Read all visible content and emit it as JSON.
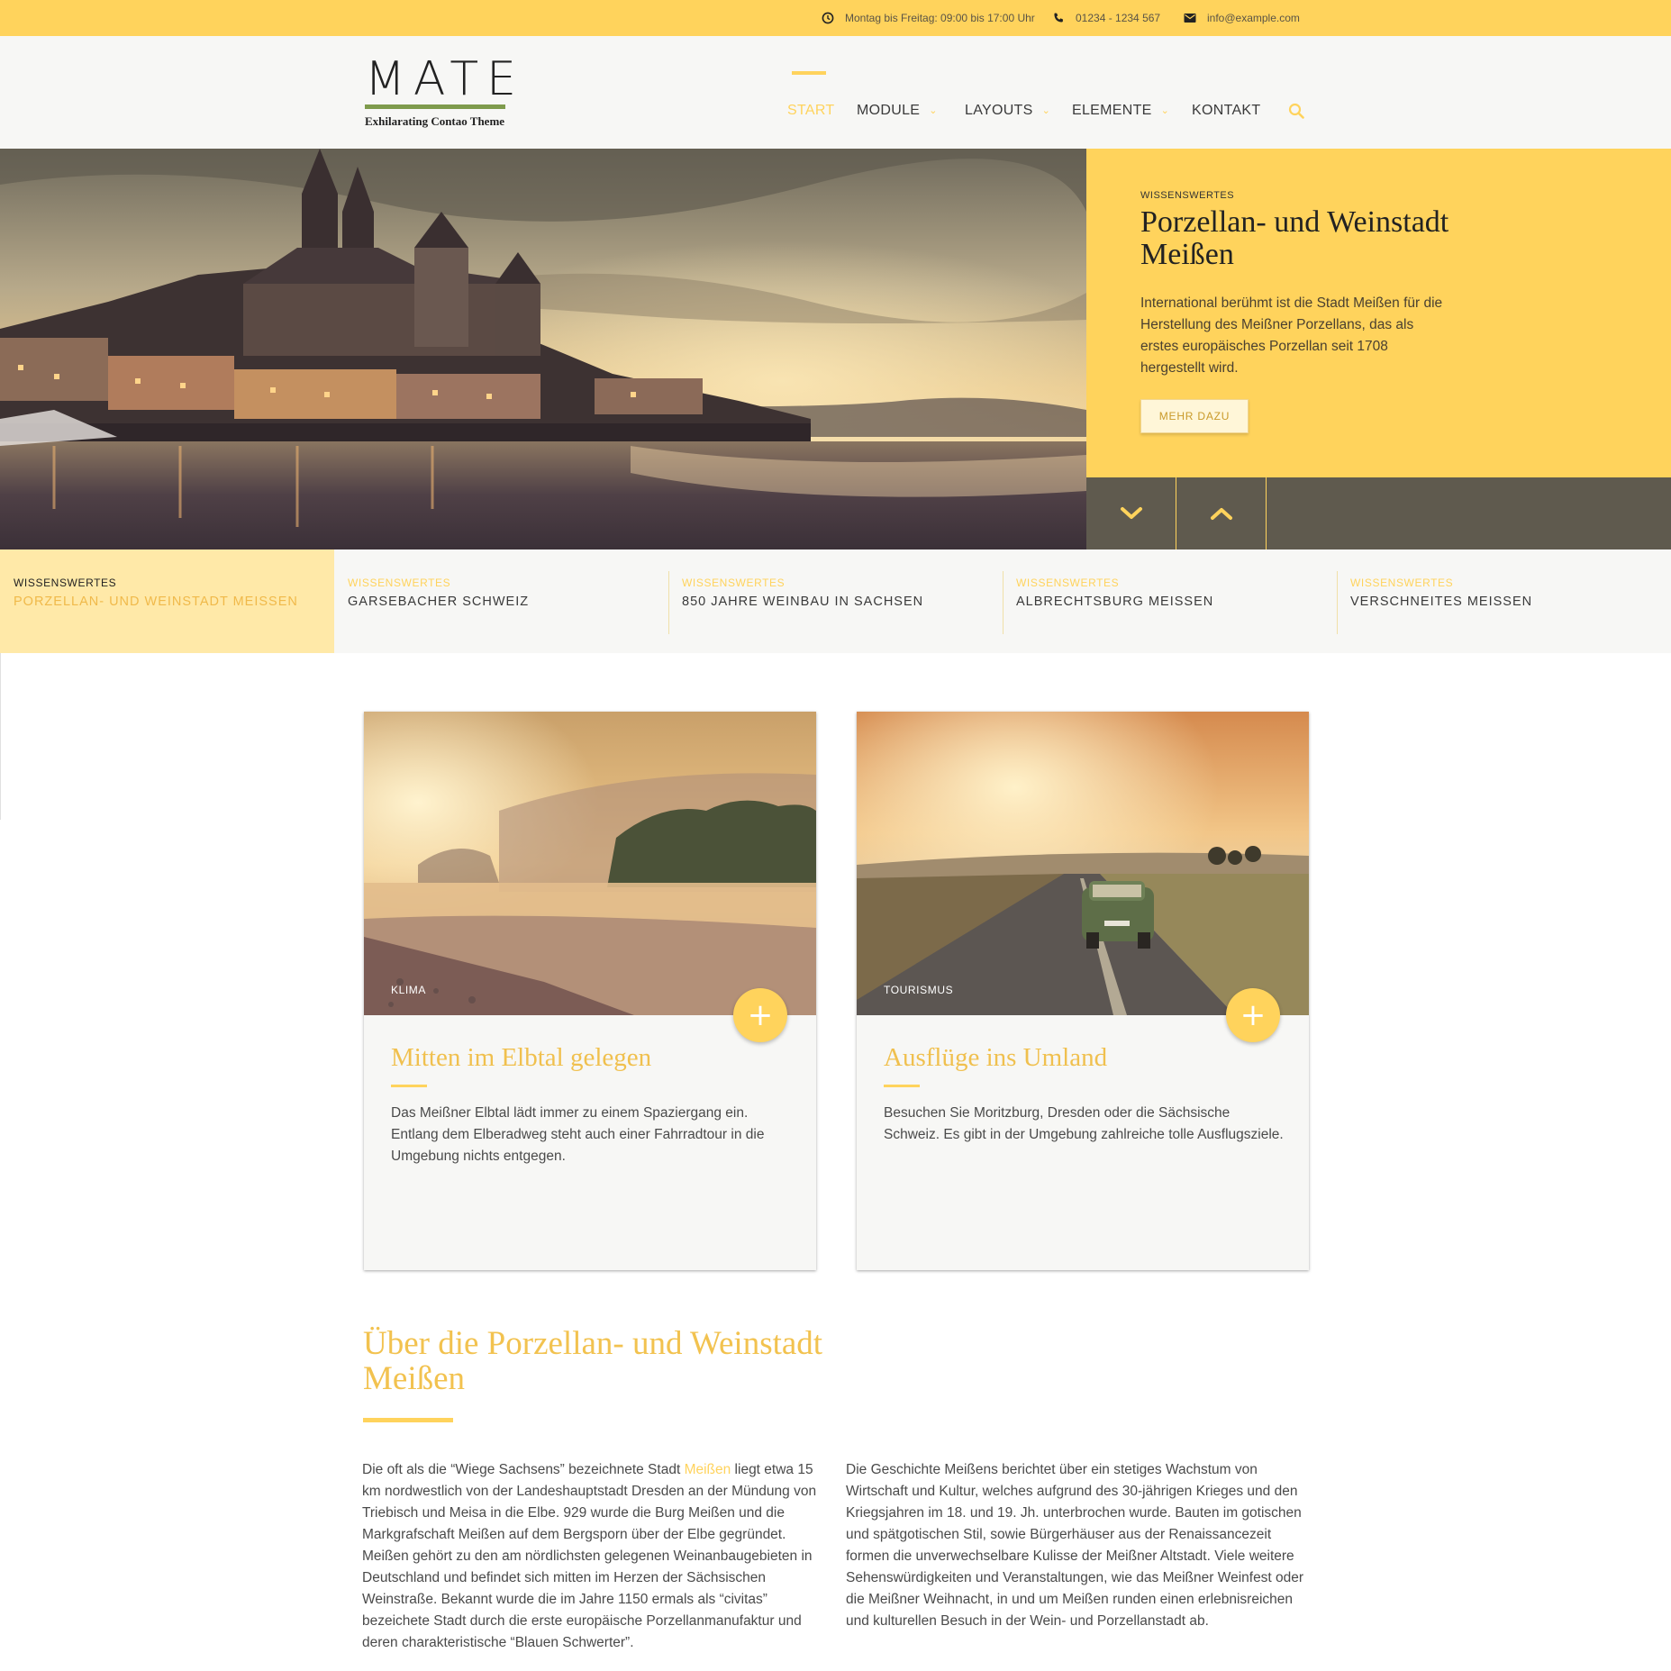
{
  "topbar": {
    "hours": "Montag bis Freitag: 09:00 bis 17:00 Uhr",
    "phone": "01234 - 1234 567",
    "email": "info@example.com"
  },
  "logo": {
    "word": "MATE",
    "tagline": "Exhilarating Contao Theme"
  },
  "nav": {
    "items": [
      "START",
      "MODULE",
      "LAYOUTS",
      "ELEMENTE",
      "KONTAKT"
    ],
    "dropdown_icon": "chevron-down-icon",
    "search_icon": "search-icon"
  },
  "hero": {
    "kicker": "WISSENSWERTES",
    "title": "Porzellan- und Weinstadt Meißen",
    "text": "International berühmt ist die Stadt Meißen für die Herstellung des Meißner Porzellans, das als erstes europäisches Porzellan seit 1708 hergestellt wird.",
    "button": "MEHR DAZU"
  },
  "tabs": [
    {
      "kicker": "WISSENSWERTES",
      "title": "PORZELLAN- UND WEINSTADT MEISSEN"
    },
    {
      "kicker": "WISSENSWERTES",
      "title": "GARSEBACHER SCHWEIZ"
    },
    {
      "kicker": "WISSENSWERTES",
      "title": "850 JAHRE WEINBAU IN SACHSEN"
    },
    {
      "kicker": "WISSENSWERTES",
      "title": "ALBRECHTSBURG MEISSEN"
    },
    {
      "kicker": "WISSENSWERTES",
      "title": "VERSCHNEITES MEISSEN"
    }
  ],
  "cards": [
    {
      "tag": "KLIMA",
      "title": "Mitten im Elbtal gelegen",
      "text": "Das Meißner Elbtal lädt immer zu einem Spaziergang ein. Entlang dem Elberadweg steht auch einer Fahrradtour in die Umgebung nichts entgegen.",
      "plus": "+"
    },
    {
      "tag": "TOURISMUS",
      "title": "Ausflüge ins Umland",
      "text": "Besuchen Sie Moritzburg, Dresden oder die Sächsische Schweiz. Es gibt in der Umgebung zahlreiche tolle Ausflugsziele.",
      "plus": "+"
    }
  ],
  "about": {
    "title": "Über die Porzellan- und Weinstadt Meißen",
    "col1_before": "Die oft als die “Wiege Sachsens” bezeichnete Stadt ",
    "col1_link": "Meißen",
    "col1_after": " liegt etwa 15 km nordwestlich von der Landeshauptstadt Dresden an der Mündung von Triebisch und Meisa in die Elbe. 929 wurde die Burg Meißen und die Markgrafschaft Meißen auf dem Bergsporn über der Elbe gegründet. Meißen gehört zu den am nördlichsten gelegenen Weinanbaugebieten in Deutschland und befindet sich mitten im Herzen der Sächsischen Weinstraße. Bekannt wurde die im Jahre 1150 ermals als “civitas” bezeichete Stadt durch die erste europäische Porzellanmanufaktur und deren charakteristische “Blauen Schwerter”.",
    "col2": "Die Geschichte Meißens berichtet über ein stetiges Wachstum von Wirtschaft und Kultur, welches aufgrund des 30-jährigen Krieges und den Kriegsjahren im 18. und 19. Jh. unterbrochen wurde. Bauten im gotischen und spätgotischen Stil, sowie Bürgerhäuser aus der Renaissancezeit formen die unverwechselbare Kulisse der Meißner Altstadt. Viele weitere Sehenswürdigkeiten und Veranstaltungen, wie das Meißner Weinfest oder die Meißner Weihnacht, in und um Meißen runden einen erlebnisreichen und kulturellen Besuch in der Wein- und Porzellanstadt ab."
  },
  "colors": {
    "accent": "#ffd35c",
    "dark": "#5f5a4e",
    "logo_green": "#7e9b4c"
  }
}
